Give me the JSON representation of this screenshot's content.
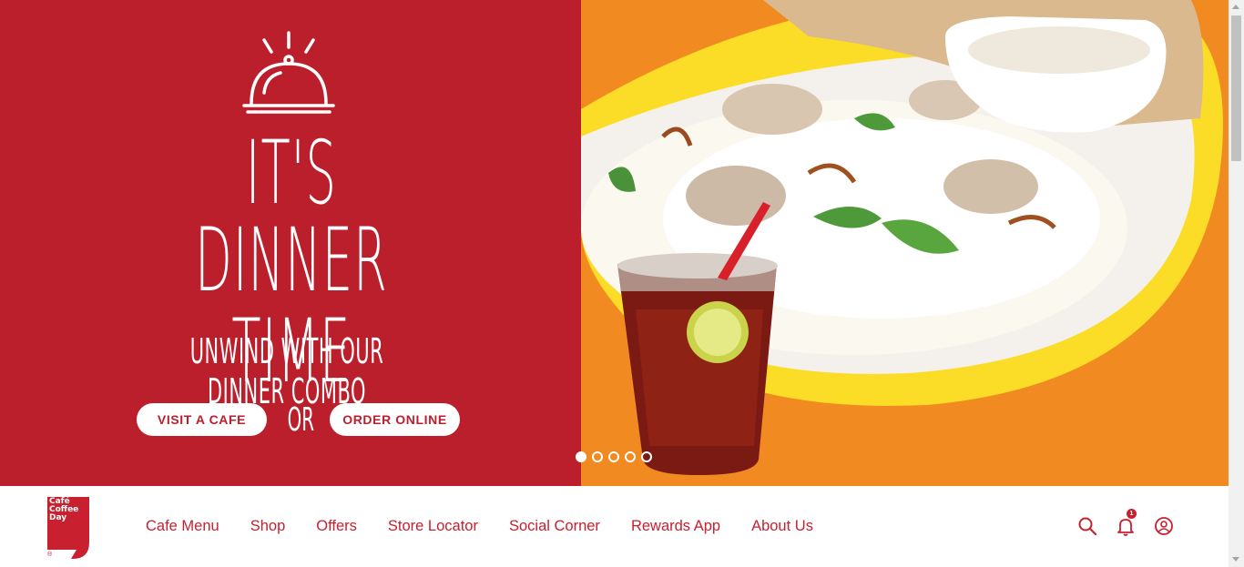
{
  "hero": {
    "headline_line1": "IT'S",
    "headline_line2": "DINNER TIME",
    "subline": "UNWIND WITH OUR DINNER COMBO",
    "visit_button": "VISIT A CAFE",
    "or_text": "OR",
    "order_button": "ORDER ONLINE",
    "slides_total": 5,
    "active_slide": 1
  },
  "logo": {
    "line1": "Café",
    "line2": "Coffee",
    "line3": "Day",
    "registered": "®"
  },
  "nav": {
    "items": [
      {
        "label": "Cafe Menu"
      },
      {
        "label": "Shop"
      },
      {
        "label": "Offers"
      },
      {
        "label": "Store Locator"
      },
      {
        "label": "Social Corner"
      },
      {
        "label": "Rewards App"
      },
      {
        "label": "About Us"
      }
    ],
    "notification_count": "1"
  },
  "icons": {
    "search": "search-icon",
    "notifications": "bell-icon",
    "account": "user-icon",
    "cloche": "cloche-icon"
  },
  "colors": {
    "brand_red": "#bc1f2c",
    "nav_red": "#c8202f",
    "hero_orange": "#f28a22",
    "hero_yellow": "#fbdc27"
  }
}
